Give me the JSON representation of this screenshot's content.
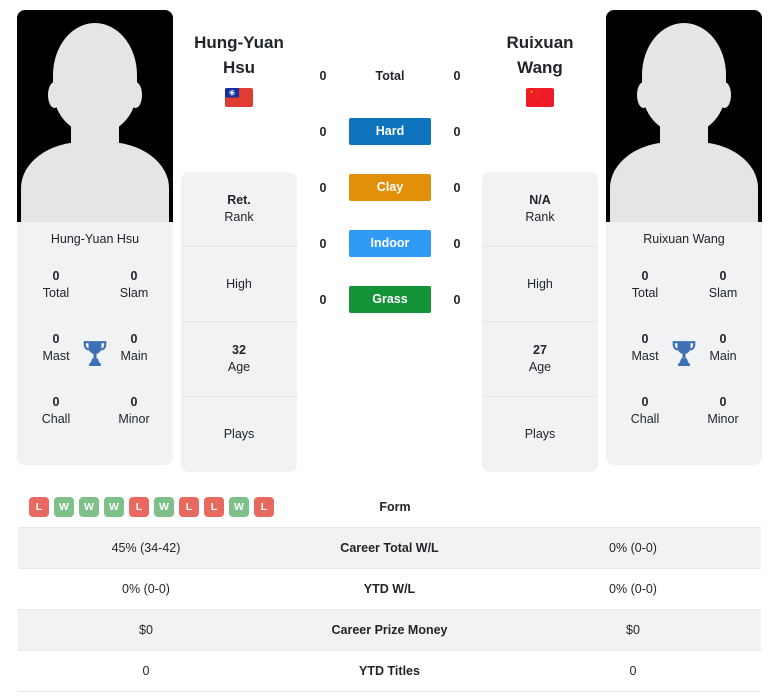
{
  "colors": {
    "hard": "#0d74bd",
    "clay": "#e2900c",
    "indoor": "#2f9bf5",
    "grass": "#149339",
    "win": "#7ec08a",
    "loss": "#e8695f",
    "trophy": "#3f6fb5",
    "card_bg": "#f1f2f3",
    "stripe_bg": "#f2f2f2"
  },
  "players": {
    "left": {
      "name": "Hung-Yuan Hsu",
      "name_line1": "Hung-Yuan",
      "name_line2": "Hsu",
      "flag": "taiwan-flag",
      "photo": "player-photo-placeholder",
      "titles": [
        {
          "value": "0",
          "label": "Total"
        },
        {
          "value": "0",
          "label": "Slam"
        },
        {
          "value": "0",
          "label": "Mast"
        },
        {
          "value": "0",
          "label": "Main"
        },
        {
          "value": "0",
          "label": "Chall"
        },
        {
          "value": "0",
          "label": "Minor"
        }
      ],
      "info": [
        {
          "value": "Ret.",
          "label": "Rank"
        },
        {
          "value": "",
          "label": "High"
        },
        {
          "value": "32",
          "label": "Age"
        },
        {
          "value": "",
          "label": "Plays"
        }
      ]
    },
    "right": {
      "name": "Ruixuan Wang",
      "name_line1": "Ruixuan",
      "name_line2": "Wang",
      "flag": "china-flag",
      "photo": "player-photo-placeholder",
      "titles": [
        {
          "value": "0",
          "label": "Total"
        },
        {
          "value": "0",
          "label": "Slam"
        },
        {
          "value": "0",
          "label": "Mast"
        },
        {
          "value": "0",
          "label": "Main"
        },
        {
          "value": "0",
          "label": "Chall"
        },
        {
          "value": "0",
          "label": "Minor"
        }
      ],
      "info": [
        {
          "value": "N/A",
          "label": "Rank"
        },
        {
          "value": "",
          "label": "High"
        },
        {
          "value": "27",
          "label": "Age"
        },
        {
          "value": "",
          "label": "Plays"
        }
      ]
    }
  },
  "head_to_head": [
    {
      "label": "Total",
      "left": "0",
      "right": "0",
      "badge": false,
      "color": ""
    },
    {
      "label": "Hard",
      "left": "0",
      "right": "0",
      "badge": true,
      "color": "#0d74bd"
    },
    {
      "label": "Clay",
      "left": "0",
      "right": "0",
      "badge": true,
      "color": "#e2900c"
    },
    {
      "label": "Indoor",
      "left": "0",
      "right": "0",
      "badge": true,
      "color": "#2f9bf5"
    },
    {
      "label": "Grass",
      "left": "0",
      "right": "0",
      "badge": true,
      "color": "#149339"
    }
  ],
  "stats_table": [
    {
      "label": "Form",
      "type": "form",
      "striped": false,
      "left_form": [
        "L",
        "W",
        "W",
        "W",
        "L",
        "W",
        "L",
        "L",
        "W",
        "L"
      ],
      "right_form": []
    },
    {
      "label": "Career Total W/L",
      "type": "text",
      "striped": true,
      "left": "45% (34-42)",
      "right": "0% (0-0)"
    },
    {
      "label": "YTD W/L",
      "type": "text",
      "striped": false,
      "left": "0% (0-0)",
      "right": "0% (0-0)"
    },
    {
      "label": "Career Prize Money",
      "type": "text",
      "striped": true,
      "left": "$0",
      "right": "$0"
    },
    {
      "label": "YTD Titles",
      "type": "text",
      "striped": false,
      "left": "0",
      "right": "0"
    }
  ]
}
